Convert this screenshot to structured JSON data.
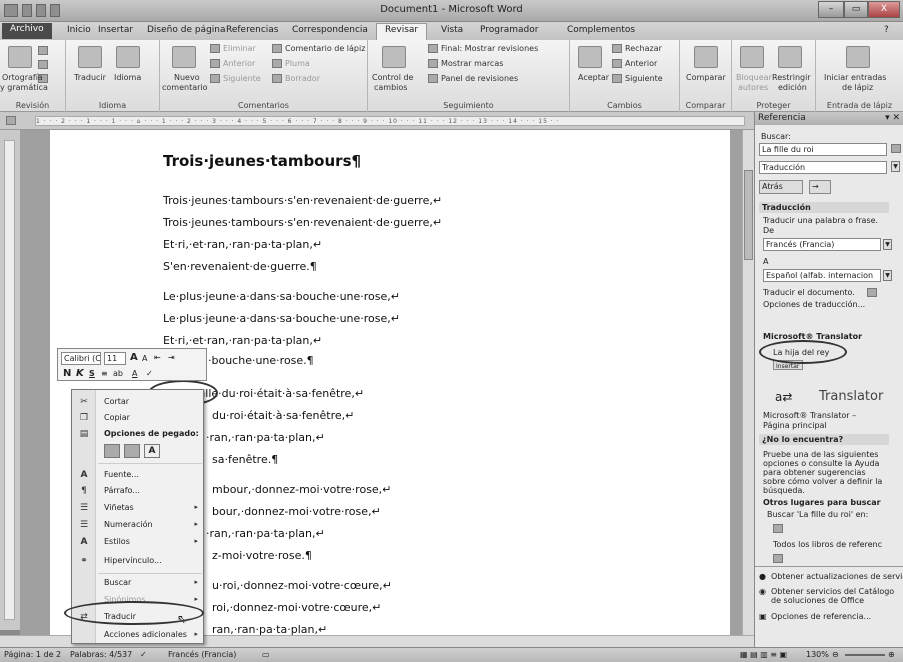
{
  "window": {
    "title": "Document1 - Microsoft Word",
    "minimize": "–",
    "maximize": "▭",
    "close": "X"
  },
  "tabs": [
    "Archivo",
    "Inicio",
    "Insertar",
    "Diseño de página",
    "Referencias",
    "Correspondencia",
    "Revisar",
    "Vista",
    "Programador",
    "Complementos"
  ],
  "active_tab": "Revisar",
  "ribbon": {
    "revision": {
      "ortografia": "Ortografía",
      "gramatica": "y gramática",
      "label": "Revisión"
    },
    "idioma": {
      "traducir": "Traducir",
      "idioma": "Idioma",
      "label": "Idioma"
    },
    "comentarios": {
      "nuevo": "Nuevo",
      "comentario": "comentario",
      "eliminar": "Eliminar",
      "anterior": "Anterior",
      "siguiente": "Siguiente",
      "comentario_lapiz": "Comentario de lápiz",
      "pluma": "Pluma",
      "borrador": "Borrador",
      "label": "Comentarios"
    },
    "seguimiento": {
      "control_de": "Control de",
      "cambios": "cambios",
      "final": "Final: Mostrar revisiones",
      "mostrar_marcas": "Mostrar marcas",
      "panel": "Panel de revisiones",
      "label": "Seguimiento"
    },
    "cambios": {
      "aceptar": "Aceptar",
      "rechazar": "Rechazar",
      "anterior": "Anterior",
      "siguiente": "Siguiente",
      "label": "Cambios"
    },
    "comparar": {
      "comparar": "Comparar",
      "label": "Comparar"
    },
    "proteger": {
      "bloquear": "Bloquear",
      "autores": "autores",
      "restringir": "Restringir",
      "edicion": "edición",
      "label": "Proteger"
    },
    "lapiz": {
      "iniciar": "Iniciar entradas",
      "de_lapiz": "de lápiz",
      "label": "Entrada de lápiz"
    }
  },
  "ruler_text": "1 · · · 2 · · · 1 · · · 1 · · · ⌂ · · · 1 · · · 2 · · · 3 · · · 4 · · · 5 · · · 6 · · · 7 · · · 8 · · · 9 · · · 10 · · · 11 · · · 12 · · · 13 · · · 14 · · · 15 · ·",
  "document": {
    "title": "Trois·jeunes·tambours¶",
    "lines": [
      "Trois·jeunes·tambours·s'en·revenaient·de·guerre,↵",
      "Trois·jeunes·tambours·s'en·revenaient·de·guerre,↵",
      "Et·ri,·et·ran,·ran·pa·ta·plan,↵",
      "S'en·revenaient·de·guerre.¶",
      "Le·plus·jeune·a·dans·sa·bouche·une·rose,↵",
      "Le·plus·jeune·a·dans·sa·bouche·une·rose,↵",
      "Et·ri,·et·ran,·ran·pa·ta·plan,↵",
      "·bouche·une·rose.¶",
      "La·fille·du·roi·était·à·sa·fenêtre,↵",
      "du·roi·était·à·sa·fenêtre,↵",
      "·ran,·ran·pa·ta·plan,↵",
      "sa·fenêtre.¶",
      "mbour,·donnez-moi·votre·rose,↵",
      "bour,·donnez-moi·votre·rose,↵",
      "·ran,·ran·pa·ta·plan,↵",
      "z-moi·votre·rose.¶",
      "u·roi,·donnez-moi·votre·cœure,↵",
      "roi,·donnez-moi·votre·cœure,↵",
      "ran,·ran·pa·ta·plan,↵"
    ]
  },
  "mini_toolbar": {
    "font": "Calibri (C",
    "size": "11",
    "grow": "A",
    "shrink": "A",
    "indent_dec": "⇤",
    "indent_inc": "⇥",
    "bold": "N",
    "italic": "K",
    "underline": "S",
    "center": "≡",
    "highlight": "ab",
    "font_color": "A",
    "format_painter": "✓"
  },
  "context_menu": {
    "items": [
      "Cortar",
      "Copiar",
      "Opciones de pegado:",
      "Fuente...",
      "Párrafo...",
      "Viñetas",
      "Numeración",
      "Estilos",
      "Hipervínculo...",
      "Buscar",
      "Sinónimos",
      "Traducir",
      "Acciones adicionales"
    ]
  },
  "pane": {
    "title": "Referencia",
    "buscar_label": "Buscar:",
    "buscar_value": "La fille du roi",
    "service": "Traducción",
    "atras": "Atrás",
    "traduccion_header": "Traducción",
    "traducir_palabra": "Traducir una palabra o frase.",
    "de": "De",
    "from_lang": "Francés (Francia)",
    "a": "A",
    "to_lang": "Español (alfab. internacion",
    "traducir_doc": "Traducir el documento.",
    "opciones": "Opciones de traducción...",
    "ms_translator": "Microsoft® Translator",
    "result": "La hija del rey",
    "insertar": "Insertar",
    "translator_logo": "Translator",
    "ms_translator_2": "Microsoft® Translator –",
    "pagina_principal": "Página principal",
    "no_encuentra": "¿No lo encuentra?",
    "help_text": [
      "Pruebe una de las siguientes",
      "opciones o consulte la Ayuda",
      "para obtener sugerencias",
      "sobre cómo volver a definir la",
      "búsqueda."
    ],
    "otros_lugares": "Otros lugares para buscar",
    "buscar_en": "Buscar 'La fille du roi' en:",
    "todos_libros": "Todos los libros de referenc",
    "obtener_act": "Obtener actualizaciones de servici",
    "obtener_serv1": "Obtener servicios del Catálogo",
    "obtener_serv2": "de soluciones de Office",
    "opciones_ref": "Opciones de referencia..."
  },
  "status": {
    "pagina": "Página: 1 de 2",
    "palabras": "Palabras: 4/537",
    "idioma": "Francés (Francia)",
    "zoom": "130%"
  }
}
